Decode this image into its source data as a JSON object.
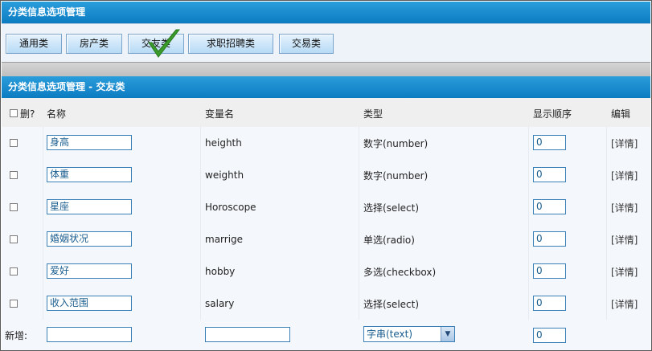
{
  "title": "分类信息选项管理",
  "tabs": [
    {
      "label": "通用类"
    },
    {
      "label": "房产类"
    },
    {
      "label": "交友类"
    },
    {
      "label": "求职招聘类"
    },
    {
      "label": "交易类"
    }
  ],
  "active_tab": "交友类",
  "section_title": "分类信息选项管理 - 交友类",
  "columns": {
    "delete": "删?",
    "name": "名称",
    "variable": "变量名",
    "type": "类型",
    "order": "显示顺序",
    "edit": "编辑"
  },
  "rows": [
    {
      "name": "身高",
      "variable": "heighth",
      "type": "数字(number)",
      "order": "0",
      "edit": "[详情]"
    },
    {
      "name": "体重",
      "variable": "weighth",
      "type": "数字(number)",
      "order": "0",
      "edit": "[详情]"
    },
    {
      "name": "星座",
      "variable": "Horoscope",
      "type": "选择(select)",
      "order": "0",
      "edit": "[详情]"
    },
    {
      "name": "婚姻状况",
      "variable": "marrige",
      "type": "单选(radio)",
      "order": "0",
      "edit": "[详情]"
    },
    {
      "name": "爱好",
      "variable": "hobby",
      "type": "多选(checkbox)",
      "order": "0",
      "edit": "[详情]"
    },
    {
      "name": "收入范围",
      "variable": "salary",
      "type": "选择(select)",
      "order": "0",
      "edit": "[详情]"
    }
  ],
  "new_row": {
    "label": "新增:",
    "name": "",
    "variable": "",
    "type_selected": "字串(text)",
    "order": "0"
  },
  "icons": {
    "active_tab_marker": "checkmark-icon",
    "select_arrow": "chevron-down-icon"
  },
  "colors": {
    "header_blue": "#0c7cc2",
    "input_border": "#3a7fb5",
    "check_green": "#3a9a2a"
  }
}
